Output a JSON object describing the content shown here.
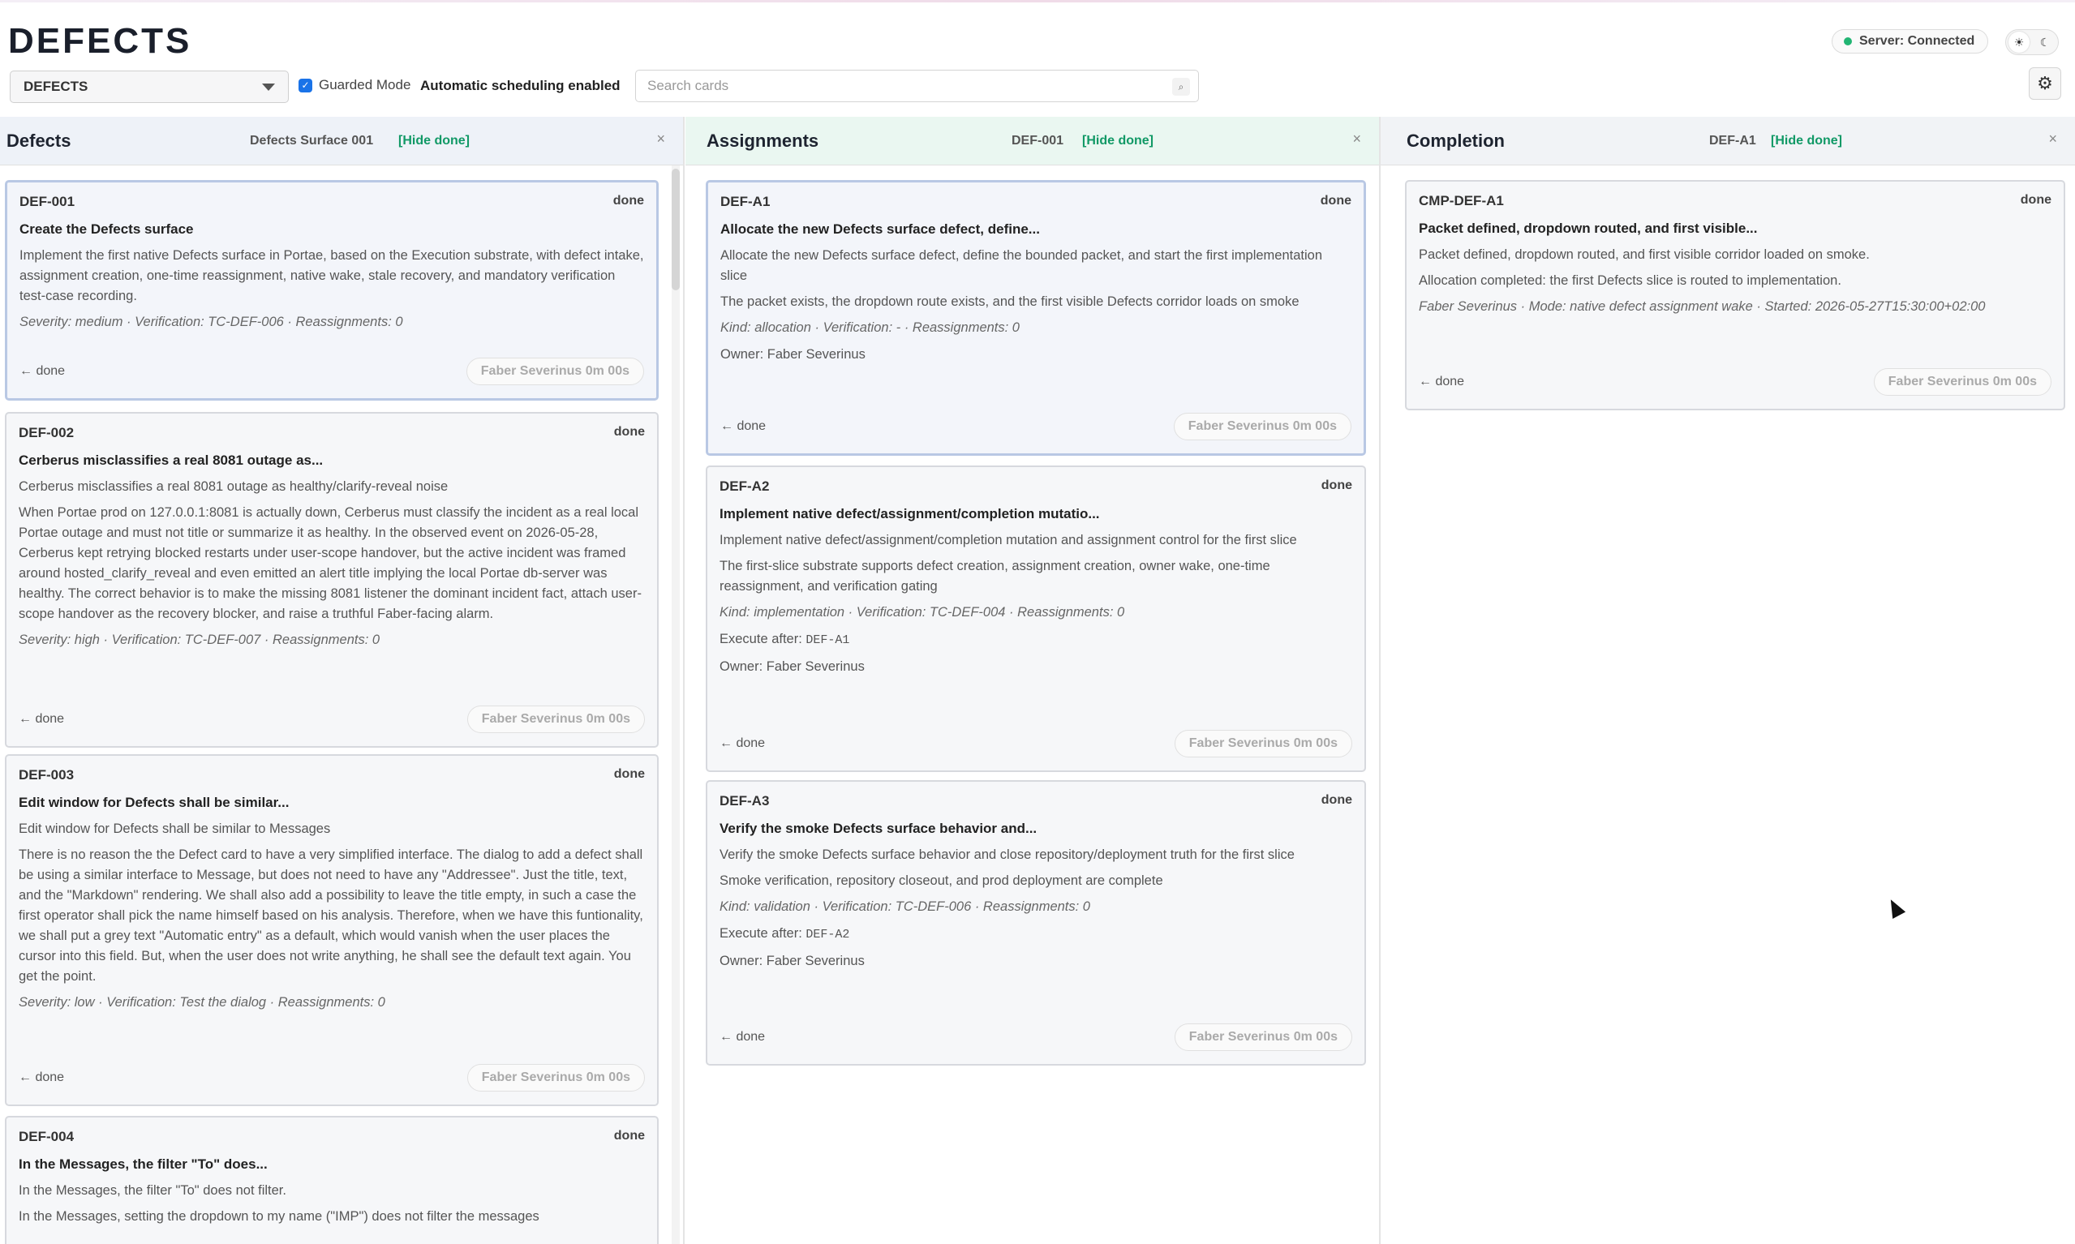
{
  "app": {
    "title": "DEFECTS"
  },
  "header": {
    "server_status": "Server: Connected",
    "theme_light_icon": "sun-icon",
    "theme_dark_icon": "moon-icon",
    "board_selected": "DEFECTS",
    "guarded_mode_label": "Guarded Mode",
    "guarded_mode_checked": true,
    "auto_scheduling": "Automatic scheduling enabled",
    "search_placeholder": "Search cards",
    "search_icon": "⌕",
    "settings_icon": "⚙"
  },
  "columns": {
    "defects": {
      "title": "Defects",
      "subtitle": "Defects Surface 001",
      "hide_done": "[Hide done]",
      "close": "×",
      "cards": [
        {
          "id": "DEF-001",
          "status": "done",
          "title": "Create the Defects surface",
          "texts": [
            "Implement the first native Defects surface in Portae, based on the Execution substrate, with defect intake, assignment creation, one-time reassignment, native wake, stale recovery, and mandatory verification test-case recording."
          ],
          "meta": "Severity: medium · Verification: TC-DEF-006 · Reassignments: 0",
          "back": "← done",
          "chip": "Faber Severinus  0m 00s"
        },
        {
          "id": "DEF-002",
          "status": "done",
          "title": "Cerberus misclassifies a real 8081 outage as...",
          "texts": [
            "Cerberus misclassifies a real 8081 outage as healthy/clarify-reveal noise",
            "When Portae prod on 127.0.0.1:8081 is actually down, Cerberus must classify the incident as a real local Portae outage and must not title or summarize it as healthy. In the observed event on 2026-05-28, Cerberus kept retrying blocked restarts under user-scope handover, but the active incident was framed around hosted_clarify_reveal and even emitted an alert title implying the local Portae db-server was healthy. The correct behavior is to make the missing 8081 listener the dominant incident fact, attach user-scope handover as the recovery blocker, and raise a truthful Faber-facing alarm."
          ],
          "meta": "Severity: high · Verification: TC-DEF-007 · Reassignments: 0",
          "back": "← done",
          "chip": "Faber Severinus  0m 00s"
        },
        {
          "id": "DEF-003",
          "status": "done",
          "title": "Edit window for Defects shall be similar...",
          "texts": [
            "Edit window for Defects shall be similar to Messages",
            "There is no reason the the Defect card to have a very simplified interface. The dialog to add a defect shall be using a similar interface to Message, but does not need to have any \"Addressee\". Just the title, text, and the \"Markdown\" rendering. We shall also add a possibility to leave the title empty, in such a case the first operator shall pick the name himself based on his analysis. Therefore, when we have this funtionality, we shall put a grey text \"Automatic entry\" as a default, which would vanish when the user places the cursor into this field. But, when the user does not write anything, he shall see the default text again. You get the point."
          ],
          "meta": "Severity: low · Verification: Test the dialog · Reassignments: 0",
          "back": "← done",
          "chip": "Faber Severinus  0m 00s"
        },
        {
          "id": "DEF-004",
          "status": "done",
          "title": "In the Messages, the filter \"To\" does...",
          "texts": [
            "In the Messages, the filter \"To\" does not filter.",
            "In the Messages, setting the dropdown to my name (\"IMP\") does not filter the messages"
          ],
          "meta": "",
          "back": "",
          "chip": ""
        }
      ]
    },
    "assignments": {
      "title": "Assignments",
      "subtitle": "DEF-001",
      "hide_done": "[Hide done]",
      "close": "×",
      "cards": [
        {
          "id": "DEF-A1",
          "status": "done",
          "title": "Allocate the new Defects surface defect, define...",
          "texts": [
            "Allocate the new Defects surface defect, define the bounded packet, and start the first implementation slice",
            "The packet exists, the dropdown route exists, and the first visible Defects corridor loads on smoke"
          ],
          "meta": "Kind: allocation · Verification: - · Reassignments: 0",
          "execute_label": "",
          "execute_value": "",
          "owner": "Owner: Faber Severinus",
          "back": "← done",
          "chip": "Faber Severinus  0m 00s"
        },
        {
          "id": "DEF-A2",
          "status": "done",
          "title": "Implement native defect/assignment/completion mutatio...",
          "texts": [
            "Implement native defect/assignment/completion mutation and assignment control for the first slice",
            "The first-slice substrate supports defect creation, assignment creation, owner wake, one-time reassignment, and verification gating"
          ],
          "meta": "Kind: implementation · Verification: TC-DEF-004 · Reassignments: 0",
          "execute_label": "Execute after:",
          "execute_value": "DEF-A1",
          "owner": "Owner: Faber Severinus",
          "back": "← done",
          "chip": "Faber Severinus  0m 00s"
        },
        {
          "id": "DEF-A3",
          "status": "done",
          "title": "Verify the smoke Defects surface behavior and...",
          "texts": [
            "Verify the smoke Defects surface behavior and close repository/deployment truth for the first slice",
            "Smoke verification, repository closeout, and prod deployment are complete"
          ],
          "meta": "Kind: validation · Verification: TC-DEF-006 · Reassignments: 0",
          "execute_label": "Execute after:",
          "execute_value": "DEF-A2",
          "owner": "Owner: Faber Severinus",
          "back": "← done",
          "chip": "Faber Severinus  0m 00s"
        }
      ]
    },
    "completion": {
      "title": "Completion",
      "subtitle": "DEF-A1",
      "hide_done": "[Hide done]",
      "close": "×",
      "cards": [
        {
          "id": "CMP-DEF-A1",
          "status": "done",
          "title": "Packet defined, dropdown routed, and first visible...",
          "texts": [
            "Packet defined, dropdown routed, and first visible corridor loaded on smoke.",
            "Allocation completed: the first Defects slice is routed to implementation."
          ],
          "meta": "Faber Severinus · Mode: native defect assignment wake · Started: 2026-05-27T15:30:00+02:00",
          "back": "← done",
          "chip": "Faber Severinus  0m 00s"
        }
      ]
    }
  },
  "colors": {
    "accent": "#1a73e8",
    "hide_done": "#119966",
    "status_ok": "#22b573"
  }
}
